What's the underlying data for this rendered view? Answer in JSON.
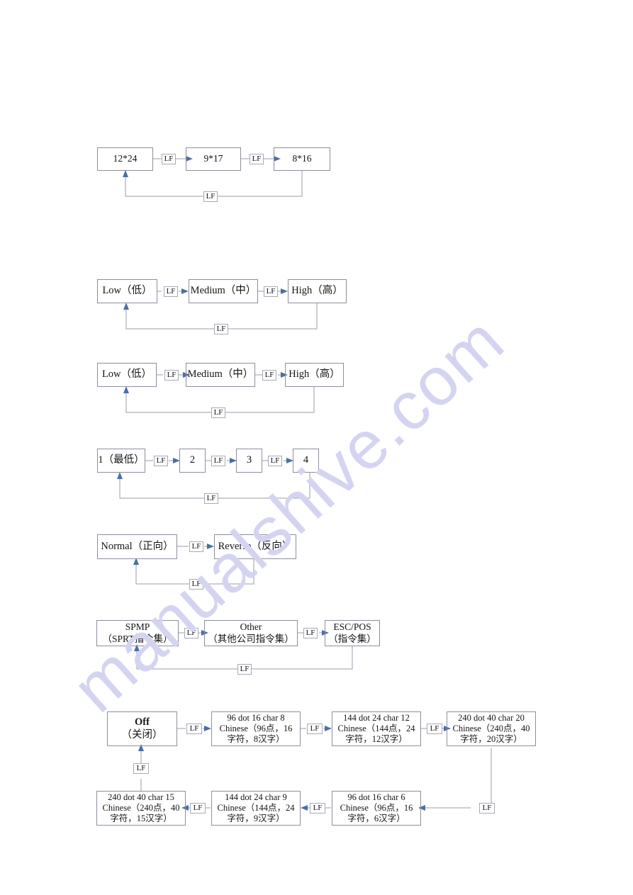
{
  "page": {
    "watermark_text": "manualshive.com",
    "watermark_color": "#d4d4f2",
    "background": "#ffffff",
    "box_border_color": "#8e8e9e",
    "wire_color": "#9b9bab",
    "arrow_color": "#4a6fa5",
    "edge_label": "LF"
  },
  "diagrams": [
    {
      "id": "font-size",
      "nodes": [
        {
          "lines": [
            "12*24"
          ]
        },
        {
          "lines": [
            "9*17"
          ]
        },
        {
          "lines": [
            "8*16"
          ]
        }
      ],
      "edges": [
        {
          "label": "LF",
          "from": "12*24",
          "to": "9*17"
        },
        {
          "label": "LF",
          "from": "9*17",
          "to": "8*16"
        },
        {
          "label": "LF",
          "from": "8*16",
          "to": "12*24"
        }
      ]
    },
    {
      "id": "density-1",
      "nodes": [
        {
          "lines": [
            "Low（低）"
          ]
        },
        {
          "lines": [
            "Medium（中）"
          ]
        },
        {
          "lines": [
            "High（高）"
          ]
        }
      ],
      "edges": [
        {
          "label": "LF",
          "from": "Low（低）",
          "to": "Medium（中）"
        },
        {
          "label": "LF",
          "from": "Medium（中）",
          "to": "High（高）"
        },
        {
          "label": "LF",
          "from": "High（高）",
          "to": "Low（低）"
        }
      ]
    },
    {
      "id": "density-2",
      "nodes": [
        {
          "lines": [
            "Low（低）"
          ]
        },
        {
          "lines": [
            "Medium（中）"
          ]
        },
        {
          "lines": [
            "High（高）"
          ]
        }
      ],
      "edges": [
        {
          "label": "LF",
          "from": "Low（低）",
          "to": "Medium（中）"
        },
        {
          "label": "LF",
          "from": "Medium（中）",
          "to": "High（高）"
        },
        {
          "label": "LF",
          "from": "High（高）",
          "to": "Low（低）"
        }
      ]
    },
    {
      "id": "level",
      "nodes": [
        {
          "lines": [
            "1（最低）"
          ]
        },
        {
          "lines": [
            "2"
          ]
        },
        {
          "lines": [
            "3"
          ]
        },
        {
          "lines": [
            "4"
          ]
        }
      ],
      "edges": [
        {
          "label": "LF",
          "from": "1（最低）",
          "to": "2"
        },
        {
          "label": "LF",
          "from": "2",
          "to": "3"
        },
        {
          "label": "LF",
          "from": "3",
          "to": "4"
        },
        {
          "label": "LF",
          "from": "4",
          "to": "1（最低）"
        }
      ]
    },
    {
      "id": "direction",
      "nodes": [
        {
          "lines": [
            "Normal（正向）"
          ]
        },
        {
          "lines": [
            "Reverse（反向）"
          ]
        }
      ],
      "edges": [
        {
          "label": "LF",
          "from": "Normal（正向）",
          "to": "Reverse（反向）"
        },
        {
          "label": "LF",
          "from": "Reverse（反向）",
          "to": "Normal（正向）"
        }
      ]
    },
    {
      "id": "command-set",
      "nodes": [
        {
          "lines": [
            "SPMP",
            "（SPRT指令集）"
          ]
        },
        {
          "lines": [
            "Other",
            "（其他公司指令集）"
          ]
        },
        {
          "lines": [
            "ESC/POS",
            "（指令集）"
          ]
        }
      ],
      "edges": [
        {
          "label": "LF",
          "from": "SPMP",
          "to": "Other"
        },
        {
          "label": "LF",
          "from": "Other",
          "to": "ESC/POS"
        },
        {
          "label": "LF",
          "from": "ESC/POS",
          "to": "SPMP"
        }
      ]
    },
    {
      "id": "dot-char",
      "nodes": [
        {
          "lines": [
            "Off",
            "（关闭）"
          ]
        },
        {
          "lines": [
            "96 dot 16 char 8",
            "Chinese（96点，16",
            "字符，8汉字）"
          ]
        },
        {
          "lines": [
            "144 dot 24 char 12",
            "Chinese（144点，24",
            "字符，12汉字）"
          ]
        },
        {
          "lines": [
            "240 dot 40 char 20",
            "Chinese（240点，40",
            "字符，20汉字）"
          ]
        },
        {
          "lines": [
            "96 dot 16 char 6",
            "Chinese（96点，16",
            "字符，6汉字）"
          ]
        },
        {
          "lines": [
            "144 dot 24 char 9",
            "Chinese（144点，24",
            "字符，9汉字）"
          ]
        },
        {
          "lines": [
            "240 dot 40 char 15",
            "Chinese（240点，40",
            "字符，15汉字）"
          ]
        }
      ],
      "edges": [
        {
          "label": "LF",
          "from": "Off",
          "to": "96 dot 16 char 8"
        },
        {
          "label": "LF",
          "from": "96 dot 16 char 8",
          "to": "144 dot 24 char 12"
        },
        {
          "label": "LF",
          "from": "144 dot 24 char 12",
          "to": "240 dot 40 char 20"
        },
        {
          "label": "LF",
          "from": "240 dot 40 char 20",
          "to": "96 dot 16 char 6"
        },
        {
          "label": "LF",
          "from": "96 dot 16 char 6",
          "to": "144 dot 24 char 9"
        },
        {
          "label": "LF",
          "from": "144 dot 24 char 9",
          "to": "240 dot 40 char 15"
        },
        {
          "label": "LF",
          "from": "240 dot 40 char 15",
          "to": "Off"
        }
      ]
    }
  ]
}
